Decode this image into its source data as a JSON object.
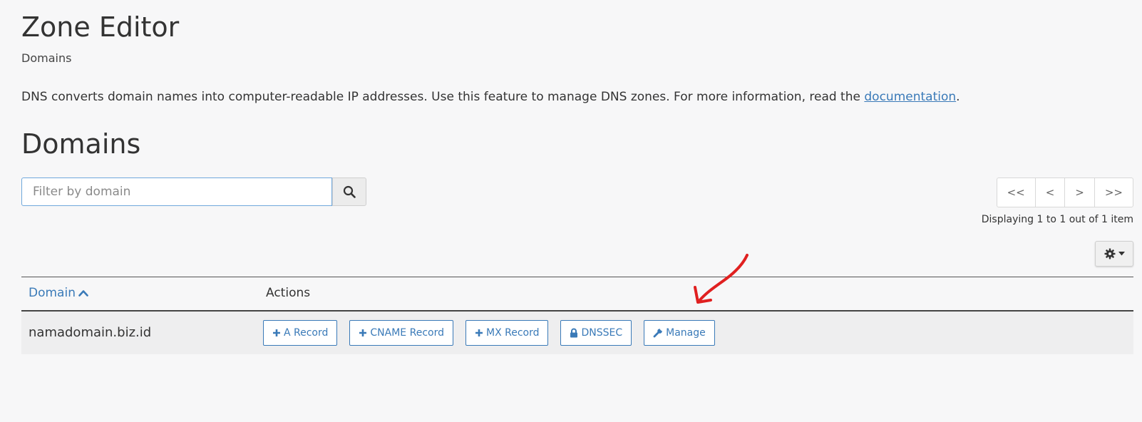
{
  "header": {
    "title": "Zone Editor",
    "breadcrumb": "Domains"
  },
  "description": {
    "text": "DNS converts domain names into computer-readable IP addresses. Use this feature to manage DNS zones. For more information, read the ",
    "link_text": "documentation",
    "suffix": "."
  },
  "section": {
    "title": "Domains"
  },
  "search": {
    "placeholder": "Filter by domain",
    "value": "",
    "icon": "search-icon"
  },
  "pagination": {
    "first": "<<",
    "prev": "<",
    "next": ">",
    "last": ">>",
    "summary": "Displaying 1 to 1 out of 1 item"
  },
  "settings": {
    "icon": "gear-icon"
  },
  "table": {
    "columns": {
      "domain": "Domain",
      "actions": "Actions"
    },
    "sort": {
      "column": "Domain",
      "direction": "ascending"
    },
    "rows": [
      {
        "domain": "namadomain.biz.id",
        "actions": [
          {
            "label": "A Record",
            "icon": "plus-icon"
          },
          {
            "label": "CNAME Record",
            "icon": "plus-icon"
          },
          {
            "label": "MX Record",
            "icon": "plus-icon"
          },
          {
            "label": "DNSSEC",
            "icon": "lock-icon"
          },
          {
            "label": "Manage",
            "icon": "wrench-icon"
          }
        ]
      }
    ]
  },
  "colors": {
    "accent": "#3a7ab8",
    "annotation": "#e02020",
    "background": "#f7f7f8"
  }
}
